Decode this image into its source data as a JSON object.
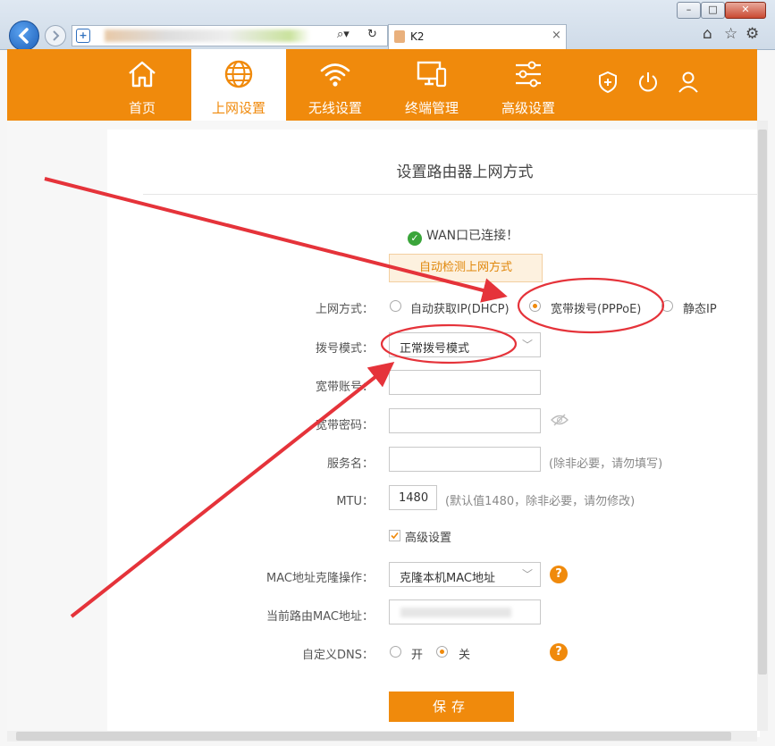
{
  "browser": {
    "window_buttons": {
      "minimize": "–",
      "maximize": "□",
      "close": "✕"
    },
    "tab_title": "K2",
    "tab_close": "×",
    "icons": [
      "back-icon",
      "forward-icon",
      "search-icon",
      "refresh-icon",
      "home-icon",
      "star-icon",
      "gear-icon"
    ]
  },
  "nav": {
    "items": [
      {
        "label": "首页",
        "icon": "home-icon"
      },
      {
        "label": "上网设置",
        "icon": "globe-icon"
      },
      {
        "label": "无线设置",
        "icon": "wifi-icon"
      },
      {
        "label": "终端管理",
        "icon": "devices-icon"
      },
      {
        "label": "高级设置",
        "icon": "sliders-icon"
      }
    ],
    "active_index": 1,
    "right_icons": [
      "shield-icon",
      "power-icon",
      "user-icon"
    ]
  },
  "page": {
    "title": "设置路由器上网方式",
    "status": "WAN口已连接！",
    "auto_detect": "自动检测上网方式",
    "wan_mode": {
      "label": "上网方式：",
      "options": [
        "自动获取IP(DHCP)",
        "宽带拨号(PPPoE)",
        "静态IP"
      ],
      "selected": "宽带拨号(PPPoE)"
    },
    "dial_mode": {
      "label": "拨号模式：",
      "value": "正常拨号模式"
    },
    "account": {
      "label": "宽带账号：",
      "value": ""
    },
    "password": {
      "label": "宽带密码：",
      "value": ""
    },
    "service": {
      "label": "服务名：",
      "value": "",
      "hint": "(除非必要，请勿填写)"
    },
    "mtu": {
      "label": "MTU：",
      "value": "1480",
      "hint": "(默认值1480，除非必要，请勿修改)"
    },
    "advanced": {
      "label": "高级设置",
      "checked": true
    },
    "mac_clone": {
      "label": "MAC地址克隆操作：",
      "value": "克隆本机MAC地址",
      "help": "?"
    },
    "current_mac": {
      "label": "当前路由MAC地址："
    },
    "custom_dns": {
      "label": "自定义DNS：",
      "on": "开",
      "off": "关",
      "selected": "关",
      "help": "?"
    },
    "save": "保存"
  },
  "colors": {
    "accent": "#f08a0c",
    "annotation": "#e5333a"
  }
}
